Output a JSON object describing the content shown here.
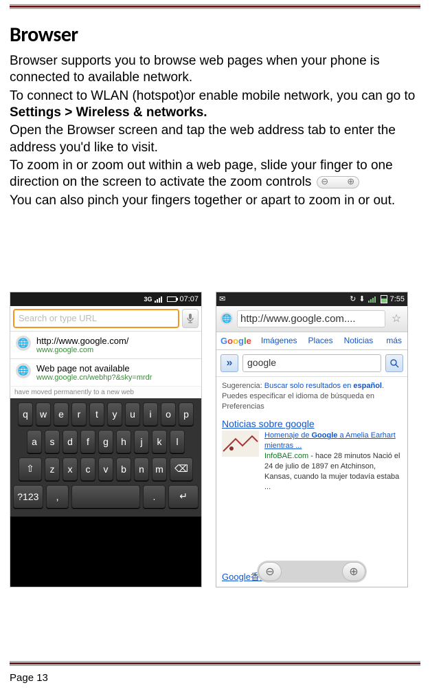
{
  "title": "Browser",
  "paragraphs": {
    "p1": "Browser supports you to browse web pages when your phone is connected to available network.",
    "p2a": "To connect to WLAN (hotspot)or enable mobile network, you can go to ",
    "p2b": "Settings > Wireless & networks.",
    "p3": "Open the Browser screen and tap the web address tab to enter the address you'd like to visit.",
    "p4": "To zoom in or zoom out within a web page, slide your finger to one direction on the screen to activate the zoom controls",
    "p5": "You can also pinch your fingers together or apart to zoom in or out."
  },
  "left": {
    "time": "07:07",
    "placeholder": "Search or type URL",
    "item1_title": "http://www.google.com/",
    "item1_sub": "www.google.com",
    "item2_title": "Web page not available",
    "item2_sub": "www.google.cn/webhp?&sky=mrdr",
    "cut": "have moved permanently to a new web",
    "r1": [
      "q",
      "w",
      "e",
      "r",
      "t",
      "y",
      "u",
      "i",
      "o",
      "p"
    ],
    "r2": [
      "a",
      "s",
      "d",
      "f",
      "g",
      "h",
      "j",
      "k",
      "l"
    ],
    "r3_shift": "⇧",
    "r3": [
      "z",
      "x",
      "c",
      "v",
      "b",
      "n",
      "m"
    ],
    "r3_del": "⌫",
    "r4_a": "?123",
    "r4_b": ",",
    "r4_d": ".",
    "r4_e": "↵"
  },
  "right": {
    "time": "7:55",
    "url": "http://www.google.com....",
    "tabs": {
      "t1": "Imágenes",
      "t2": "Places",
      "t3": "Noticias",
      "more": "más"
    },
    "chev": "»",
    "query": "google",
    "sugg_a": "Sugerencia: ",
    "sugg_link": "Buscar solo resultados en ",
    "sugg_bold": "español",
    "sugg_dot": ".",
    "sugg_b": "Puedes especificar el idioma de búsqueda en Preferencias",
    "news_head": "Noticias sobre google",
    "news_title_a": "Homenaje de ",
    "news_title_b": "Google",
    "news_title_c": " a Amelia Earhart mientras ...",
    "news_src": "InfoBAE.com",
    "news_rest": " - hace 28 minutos Nació el 24 de julio de 1897 en Atchinson, Kansas, cuando la mujer todavía estaba ...",
    "footer": "Google香港"
  },
  "page": "Page 13"
}
